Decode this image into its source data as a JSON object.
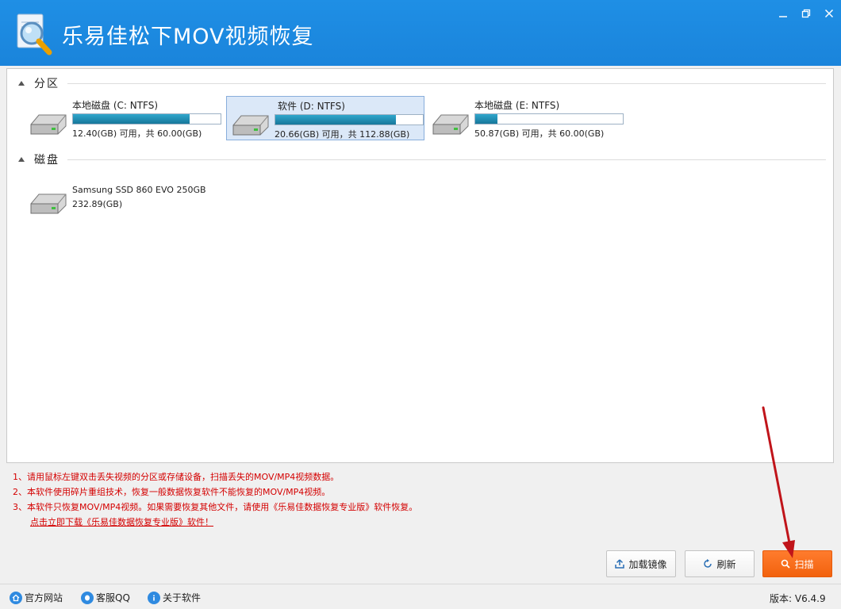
{
  "app": {
    "title": "乐易佳松下MOV视频恢复"
  },
  "partitions": {
    "header": "分区",
    "items": [
      {
        "name": "本地磁盘 (C: NTFS)",
        "capacity": "12.40(GB) 可用，共 60.00(GB)",
        "used_fraction": 0.793,
        "selected": false
      },
      {
        "name": "软件 (D: NTFS)",
        "capacity": "20.66(GB) 可用，共 112.88(GB)",
        "used_fraction": 0.817,
        "selected": true
      },
      {
        "name": "本地磁盘 (E: NTFS)",
        "capacity": "50.87(GB) 可用，共 60.00(GB)",
        "used_fraction": 0.152,
        "selected": false
      }
    ]
  },
  "disks": {
    "header": "磁盘",
    "items": [
      {
        "name": "Samsung SSD 860 EVO 250GB",
        "size": "232.89(GB)"
      }
    ]
  },
  "notes": {
    "lines": [
      "1、请用鼠标左键双击丢失视频的分区或存储设备，扫描丢失的MOV/MP4视频数据。",
      "2、本软件使用碎片重组技术，恢复一般数据恢复软件不能恢复的MOV/MP4视频。",
      "3、本软件只恢复MOV/MP4视频。如果需要恢复其他文件，请使用《乐易佳数据恢复专业版》软件恢复。"
    ],
    "download_link": "点击立即下载《乐易佳数据恢复专业版》软件！"
  },
  "buttons": {
    "load_image": "加载镜像",
    "refresh": "刷新",
    "scan": "扫描"
  },
  "statusbar": {
    "website": "官方网站",
    "support_qq": "客服QQ",
    "about": "关于软件",
    "version": "版本: V6.4.9"
  },
  "colors": {
    "titlebar": "#1a84db",
    "scan_button": "#f2620e",
    "notes_text": "#d40000",
    "selection": "#dbe8f8",
    "annotation_arrow": "#c0141a"
  }
}
